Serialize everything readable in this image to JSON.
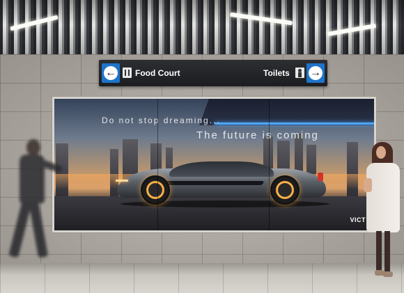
{
  "wayfinding_sign": {
    "left_label": "Food Court",
    "left_arrow_icon": "arrow-left-icon",
    "left_symbol_icon": "cutlery-icon",
    "right_label": "Toilets",
    "right_arrow_icon": "arrow-right-icon",
    "right_symbol_icon": "person-icon",
    "arrow_box_color": "#1e74c9"
  },
  "display": {
    "headline_1": "Do not stop dreaming...",
    "headline_2": "The future is coming",
    "brand": "VICT"
  }
}
